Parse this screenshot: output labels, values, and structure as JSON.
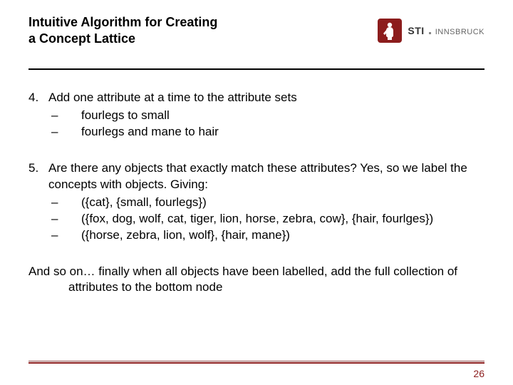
{
  "header": {
    "title_line1": "Intuitive Algorithm for Creating",
    "title_line2": "a Concept Lattice",
    "logo": {
      "sti": "STI",
      "innsbruck": "INNSBRUCK"
    }
  },
  "items": [
    {
      "num": "4.",
      "lead": "Add one attribute at a time to the attribute sets",
      "subs": [
        "fourlegs to small",
        "fourlegs and mane to hair"
      ]
    },
    {
      "num": "5.",
      "lead": "Are there any objects that exactly match these attributes? Yes, so we label the concepts with objects. Giving:",
      "subs": [
        "({cat}, {small, fourlegs})",
        "({fox, dog, wolf, cat, tiger, lion, horse, zebra, cow}, {hair, fourlges})",
        "({horse, zebra, lion, wolf}, {hair, mane})"
      ]
    }
  ],
  "closing": "And so on… finally when all objects have been labelled, add the full collection of attributes to the bottom node",
  "page_number": "26",
  "dash": "–"
}
